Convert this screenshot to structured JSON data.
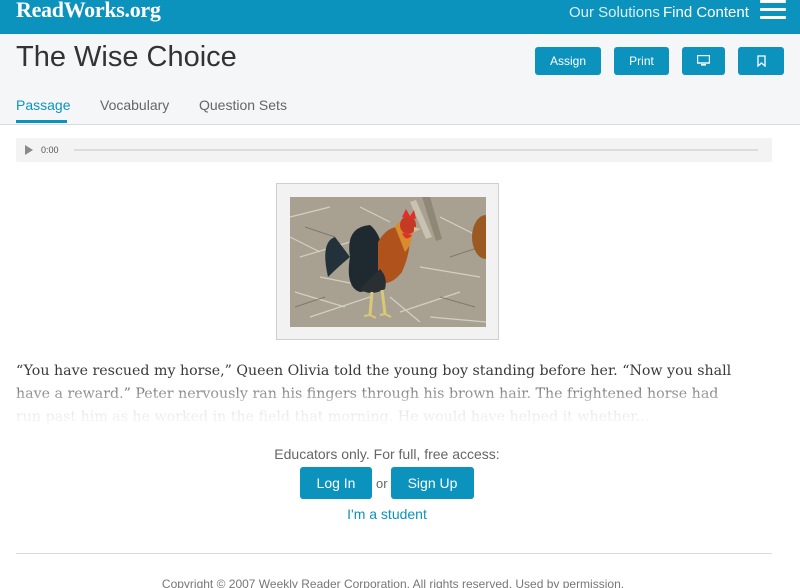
{
  "topbar": {
    "logo": "ReadWorks.org",
    "nav": {
      "solutions": "Our Solutions",
      "find_content": "Find Content"
    },
    "menu_icon": "hamburger-menu-icon"
  },
  "header": {
    "title": "The Wise Choice",
    "buttons": {
      "assign": "Assign",
      "print": "Print",
      "present_icon": "monitor-icon",
      "bookmark_icon": "bookmark-icon"
    },
    "tabs": {
      "passage": "Passage",
      "vocabulary": "Vocabulary",
      "question_sets": "Question Sets"
    }
  },
  "audio": {
    "time": "0:00",
    "play_icon": "play-icon"
  },
  "passage": {
    "text": "“You have rescued my horse,” Queen Olivia told the young boy standing before her. “Now you shall have a reward.” Peter nervously ran his fingers through his brown hair. The frightened horse had run past him as he worked in the field that morning. He would have helped it whether..."
  },
  "access": {
    "prompt": "Educators only. For full, free access:",
    "login": "Log In",
    "or": "or",
    "signup": "Sign Up",
    "student": "I'm a student"
  },
  "footer": {
    "copyright": "Copyright © 2007 Weekly Reader Corporation. All rights reserved. Used by permission."
  },
  "colors": {
    "brand": "#0c93bd"
  }
}
